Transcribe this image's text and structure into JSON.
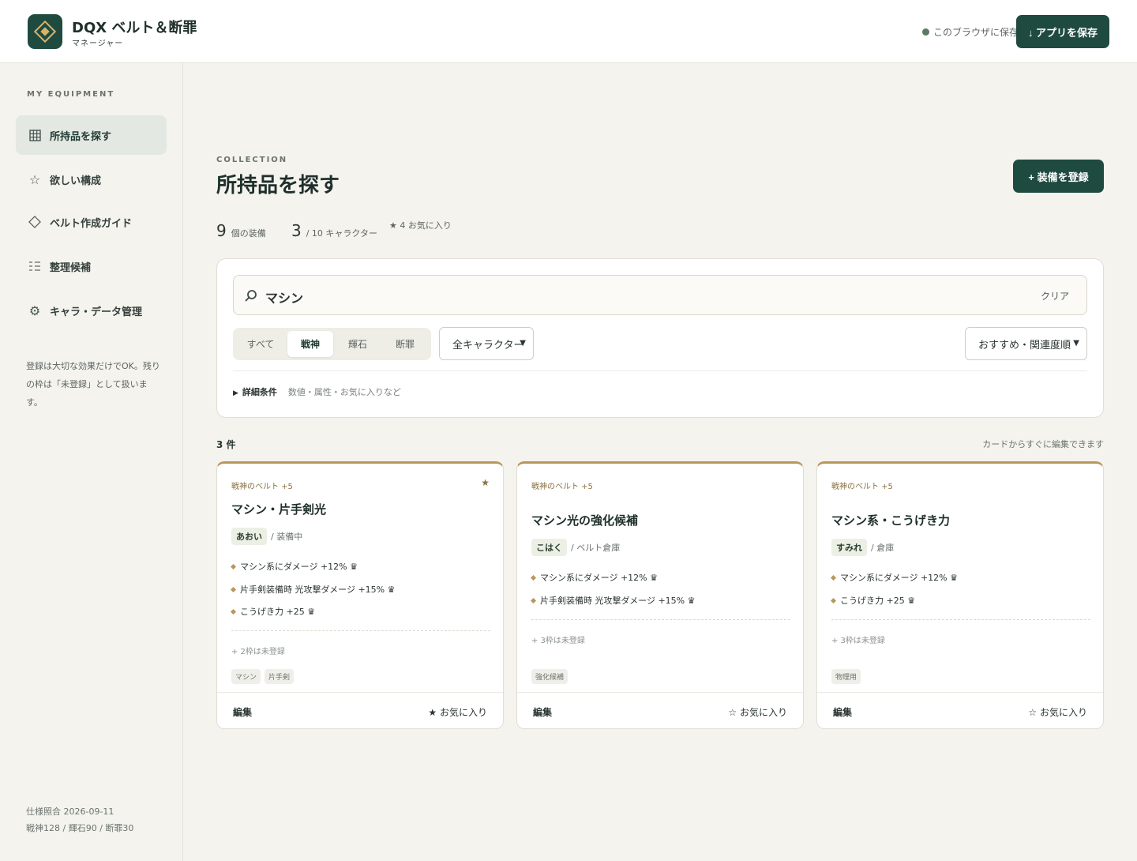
{
  "app": {
    "title": "DQX ベルト＆断罪",
    "subtitle": "マネージャー",
    "save_status": "このブラウザに保存",
    "save_app_label": "↓ アプリを保存"
  },
  "sidebar": {
    "section_label": "MY EQUIPMENT",
    "items": [
      {
        "label": "所持品を探す",
        "icon": "grid-icon"
      },
      {
        "label": "欲しい構成",
        "icon": "star-outline-icon"
      },
      {
        "label": "ベルト作成ガイド",
        "icon": "diamond-icon"
      },
      {
        "label": "整理候補",
        "icon": "list-icon"
      },
      {
        "label": "キャラ・データ管理",
        "icon": "gear-icon"
      }
    ],
    "note": "登録は大切な効果だけでOK。残りの枠は「未登録」として扱います。",
    "footer_line1": "仕様照合 2026-09-11",
    "footer_line2": "戦神128 / 輝石90 / 断罪30"
  },
  "main": {
    "eyebrow": "COLLECTION",
    "title": "所持品を探す",
    "register_label": "+ 装備を登録",
    "stats": {
      "equip_count": "9",
      "equip_label": "個の装備",
      "char_count": "3",
      "char_label": "/ 10 キャラクター",
      "fav_label": "★ 4 お気に入り"
    }
  },
  "filters": {
    "search_value": "マシン",
    "clear_label": "クリア",
    "segments": [
      "すべて",
      "戦神",
      "輝石",
      "断罪"
    ],
    "active_segment": "戦神",
    "character_select": "全キャラクター",
    "sort_select": "おすすめ・関連度順",
    "details_label": "詳細条件",
    "details_hint": "数値・属性・お気に入りなど"
  },
  "results": {
    "count_label": "3 件",
    "hint": "カードからすぐに編集できます",
    "edit_label": "編集",
    "fav_label": "お気に入り"
  },
  "cards": [
    {
      "series": "戦神のベルト +5",
      "name": "マシン・片手剣光",
      "character": "あおい",
      "location": "/ 装備中",
      "favorite": true,
      "fav_icon": "★",
      "effects": [
        "マシン系にダメージ +12% ♛",
        "片手剣装備時 光攻撃ダメージ +15% ♛",
        "こうげき力 +25 ♛"
      ],
      "empty_slots": "+ 2枠は未登録",
      "tags": [
        "マシン",
        "片手剣"
      ]
    },
    {
      "series": "戦神のベルト +5",
      "name": "マシン光の強化候補",
      "character": "こはく",
      "location": "/ ベルト倉庫",
      "favorite": false,
      "fav_icon": "☆",
      "effects": [
        "マシン系にダメージ +12% ♛",
        "片手剣装備時 光攻撃ダメージ +15% ♛"
      ],
      "empty_slots": "+ 3枠は未登録",
      "tags": [
        "強化候補"
      ]
    },
    {
      "series": "戦神のベルト +5",
      "name": "マシン系・こうげき力",
      "character": "すみれ",
      "location": "/ 倉庫",
      "favorite": false,
      "fav_icon": "☆",
      "effects": [
        "マシン系にダメージ +12% ♛",
        "こうげき力 +25 ♛"
      ],
      "empty_slots": "+ 3枠は未登録",
      "tags": [
        "物理用"
      ]
    }
  ]
}
